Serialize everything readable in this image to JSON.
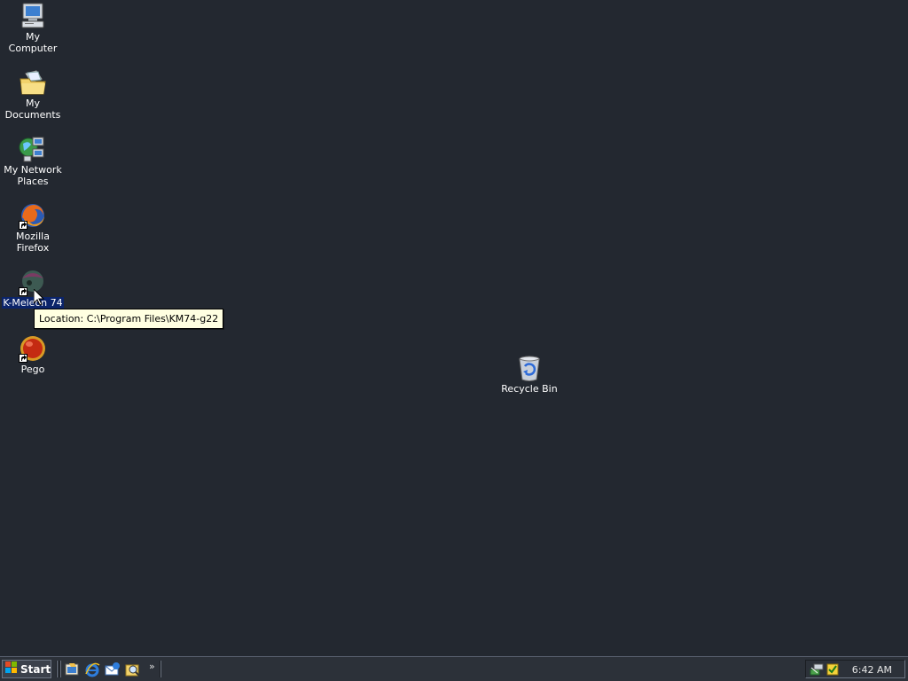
{
  "desktop": {
    "icons": [
      {
        "label": "My Computer",
        "icon": "computer-icon"
      },
      {
        "label": "My Documents",
        "icon": "documents-folder-icon"
      },
      {
        "label": "My Network Places",
        "icon": "network-places-icon"
      },
      {
        "label": "Mozilla Firefox",
        "icon": "firefox-icon"
      },
      {
        "label": "K-Meleon 74",
        "icon": "k-meleon-icon"
      },
      {
        "label": "Pego",
        "icon": "pego-icon"
      },
      {
        "label": "Recycle Bin",
        "icon": "recycle-bin-icon"
      }
    ],
    "tooltip": "Location: C:\\Program Files\\KM74-g22",
    "background_color": "#232830",
    "selection_color": "#0b246a"
  },
  "taskbar": {
    "start_label": "Start",
    "quick_launch": [
      "show-desktop-icon",
      "internet-explorer-icon",
      "outlook-express-icon",
      "search-icon"
    ],
    "chevron": "»",
    "tray_icons": [
      "network-tray-icon",
      "security-tray-icon"
    ],
    "clock": "6:42 AM"
  }
}
